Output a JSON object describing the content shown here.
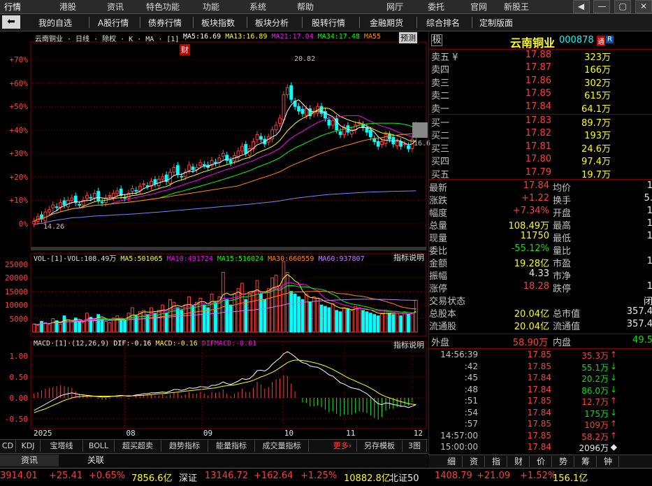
{
  "menu": [
    "行情",
    "港股",
    "资讯",
    "特色功能",
    "功能",
    "系统",
    "帮助",
    "网厅",
    "委托",
    "官网",
    "新股王"
  ],
  "window_buttons": [
    "◀",
    "—",
    "▢",
    "✕"
  ],
  "nav": [
    "我的自选",
    "A股行情",
    "债券行情",
    "板块指数",
    "板块分析",
    "股转行情",
    "金融期货",
    "综合排名",
    "定制版面"
  ],
  "main_chart": {
    "title": "云南铜业 · 日线 · 除权 · K · MA · [1] ·",
    "ma_legend": [
      {
        "text": "MA5:16.69",
        "color": "#ffffff"
      },
      {
        "text": "MA13:16.89",
        "color": "#ffff00"
      },
      {
        "text": "MA21:17.04",
        "color": "#ff00ff"
      },
      {
        "text": "MA34:17.48",
        "color": "#00ff00"
      },
      {
        "text": "MA55",
        "color": "#ff8c00"
      }
    ],
    "predict_btn": "预测",
    "cai_badge": "财",
    "y_ticks": [
      "+70%",
      "+60%",
      "+50%",
      "+40%",
      "+30%",
      "+20%",
      "+10%",
      "0%"
    ],
    "high_label": "20.82",
    "low_label": "14.26",
    "last_label": "16.6"
  },
  "vol_chart": {
    "legend": [
      {
        "text": "VOL·[1]·VOL:108.49万",
        "color": "#e0e0e0"
      },
      {
        "text": "MA5:501065",
        "color": "#ffff00"
      },
      {
        "text": "MA10:491724",
        "color": "#ff00ff"
      },
      {
        "text": "MA15:516024",
        "color": "#00ff00"
      },
      {
        "text": "MA30:660559",
        "color": "#ff8c00"
      },
      {
        "text": "MA60:937807",
        "color": "#c080ff"
      }
    ],
    "explain": "指标说明",
    "y_ticks": [
      "25000",
      "20000",
      "15000",
      "10000",
      "5000"
    ]
  },
  "macd_chart": {
    "legend": [
      {
        "text": "MACD·[1]·(12,26,9)",
        "color": "#e0e0e0"
      },
      {
        "text": "DIF:-0.16",
        "color": "#ffffff"
      },
      {
        "text": "MACD:-0.16",
        "color": "#ffff00"
      },
      {
        "text": "DIFMACD:-0.01",
        "color": "#ff00ff"
      }
    ],
    "explain": "指标说明",
    "y_ticks": [
      "1.00",
      "0.50",
      "0.00",
      "-0.50"
    ],
    "x_ticks": [
      "2025",
      "08",
      "09",
      "10",
      "11",
      "12"
    ]
  },
  "index_tabs": [
    "CD",
    "KDJ",
    "宝塔线",
    "BOLL",
    "超买超卖",
    "趋势指标",
    "能量指标",
    "成交量指标",
    "更多›",
    "另存模板",
    "3图"
  ],
  "sub_tabs": [
    "资讯",
    "关联"
  ],
  "right_tabs": [
    "细",
    "资",
    "指",
    "财",
    "价",
    "势",
    "筹",
    "钟"
  ],
  "stock": {
    "flag": "极",
    "name": "云南铜业",
    "code": "000878",
    "badges": [
      "通",
      "R"
    ]
  },
  "asks": [
    {
      "label": "卖五 ¥",
      "price": "17.88",
      "vol": "323万"
    },
    {
      "label": "卖四",
      "price": "17.87",
      "vol": "166万"
    },
    {
      "label": "卖三",
      "price": "17.86",
      "vol": "302万"
    },
    {
      "label": "卖二",
      "price": "17.85",
      "vol": "615万"
    },
    {
      "label": "卖一",
      "price": "17.84",
      "vol": "64.1万"
    }
  ],
  "bids": [
    {
      "label": "买一",
      "price": "17.83",
      "vol": "89.7万"
    },
    {
      "label": "买二",
      "price": "17.82",
      "vol": "193万"
    },
    {
      "label": "买三",
      "price": "17.81",
      "vol": "24.6万"
    },
    {
      "label": "买四",
      "price": "17.80",
      "vol": "97.4万"
    },
    {
      "label": "买五",
      "price": "17.79",
      "vol": "19.7万"
    }
  ],
  "stats": [
    {
      "l": "最新",
      "v": "17.84",
      "c": "red",
      "l2": "均价",
      "v2": "1"
    },
    {
      "l": "涨跌",
      "v": "+1.22",
      "c": "red",
      "l2": "换手",
      "v2": "5."
    },
    {
      "l": "幅度",
      "v": "+7.34%",
      "c": "red",
      "l2": "开盘",
      "v2": "1"
    },
    {
      "l": "总量",
      "v": "108.49万",
      "c": "yellow",
      "l2": "最高",
      "v2": "1"
    },
    {
      "l": "现量",
      "v": "11750",
      "c": "yellow",
      "l2": "最低",
      "v2": "1"
    },
    {
      "l": "委比",
      "v": "-55.12%",
      "c": "green",
      "l2": "量比",
      "v2": ""
    },
    {
      "l": "金额",
      "v": "19.28亿",
      "c": "yellow",
      "l2": "市盈",
      "v2": "1"
    },
    {
      "l": "振幅",
      "v": "4.33",
      "c": "white",
      "l2": "市净",
      "v2": ""
    },
    {
      "l": "涨停",
      "v": "18.28",
      "c": "red",
      "l2": "跌停",
      "v2": "1"
    },
    {
      "l": "交易状态",
      "v": "",
      "c": "white",
      "l2": "",
      "v2": "闭"
    },
    {
      "l": "总股本",
      "v": "20.04亿",
      "c": "yellow",
      "l2": "总市值",
      "v2": "357.4"
    },
    {
      "l": "流通股",
      "v": "20.04亿",
      "c": "yellow",
      "l2": "流通值",
      "v2": "357.4"
    }
  ],
  "outer_inner": {
    "out_l": "外盘",
    "out_v": "58.90万",
    "in_l": "内盘",
    "in_v": "49.5"
  },
  "ticks": [
    {
      "t": "14:56:39",
      "p": "17.85",
      "v": "35.3万",
      "d": "↑",
      "dc": "red"
    },
    {
      "t": ":42",
      "p": "17.85",
      "v": "55.1万",
      "d": "↓",
      "dc": "green"
    },
    {
      "t": ":45",
      "p": "17.84",
      "v": "20.2万",
      "d": "↓",
      "dc": "green"
    },
    {
      "t": ":48",
      "p": "17.84",
      "v": "86.0万",
      "d": "↓",
      "dc": "green"
    },
    {
      "t": ":51",
      "p": "17.85",
      "v": "12.7万",
      "d": "↑",
      "dc": "red"
    },
    {
      "t": ":54",
      "p": "17.84",
      "v": "175万",
      "d": "↓",
      "dc": "green"
    },
    {
      "t": ":57",
      "p": "17.85",
      "v": "109万",
      "d": "↑",
      "dc": "red"
    },
    {
      "t": "14:57:00",
      "p": "17.85",
      "v": "58.2万",
      "d": "↑",
      "dc": "red"
    },
    {
      "t": "15:00:00",
      "p": "17.84",
      "v": "2096万",
      "d": "◆",
      "dc": "white"
    }
  ],
  "status": [
    {
      "text": "3914.01",
      "c": "red"
    },
    {
      "text": "+25.41",
      "c": "red"
    },
    {
      "text": "+0.65%",
      "c": "red"
    },
    {
      "text": "7856.6亿",
      "c": "yellow"
    },
    {
      "text": "深证",
      "c": "white"
    },
    {
      "text": "13146.72",
      "c": "red"
    },
    {
      "text": "+162.64",
      "c": "red"
    },
    {
      "text": "+1.25%",
      "c": "red"
    },
    {
      "text": "10882.8亿",
      "c": "yellow"
    },
    {
      "text": "北证50",
      "c": "white"
    },
    {
      "text": "1408.79",
      "c": "red"
    },
    {
      "text": "+21.09",
      "c": "red"
    },
    {
      "text": "+1.52%",
      "c": "red"
    },
    {
      "text": "156.1亿",
      "c": "yellow"
    }
  ],
  "colors": {
    "up": "#ff3c3c",
    "down": "#00ffff",
    "grid": "#800000",
    "bg": "#000000"
  },
  "chart_data": {
    "type": "candlestick",
    "title": "云南铜业 日线",
    "ylabel": "",
    "ylim_pct": [
      -3,
      73
    ],
    "x_ticks": [
      "2025",
      "08",
      "09",
      "10",
      "11",
      "12"
    ],
    "close_pct": [
      1,
      3,
      2,
      5,
      6,
      8,
      7,
      9,
      8,
      10,
      11,
      9,
      8,
      10,
      12,
      11,
      13,
      10,
      9,
      11,
      12,
      13,
      14,
      12,
      11,
      13,
      15,
      14,
      16,
      17,
      16,
      18,
      17,
      19,
      20,
      18,
      22,
      24,
      21,
      20,
      22,
      25,
      23,
      24,
      26,
      25,
      24,
      27,
      26,
      28,
      30,
      27,
      26,
      29,
      31,
      33,
      30,
      32,
      35,
      38,
      36,
      34,
      37,
      40,
      42,
      45,
      55,
      58,
      53,
      50,
      48,
      47,
      49,
      46,
      48,
      50,
      47,
      45,
      42,
      44,
      40,
      38,
      41,
      39,
      40,
      42,
      43,
      41,
      39,
      37,
      35,
      33,
      35,
      38,
      36,
      34,
      35,
      33,
      34,
      32,
      36,
      42
    ],
    "volume": [
      3000,
      2500,
      4000,
      3500,
      2800,
      5000,
      4200,
      3000,
      6000,
      4500,
      3800,
      5200,
      4000,
      3600,
      7000,
      5500,
      4200,
      6500,
      5000,
      4000,
      3500,
      5200,
      6000,
      4800,
      4500,
      7000,
      9000,
      6000,
      7500,
      8000,
      6500,
      9000,
      7000,
      8000,
      10000,
      7000,
      12000,
      11000,
      9000,
      8000,
      10000,
      13000,
      9500,
      11000,
      12500,
      10000,
      9000,
      14000,
      11000,
      13000,
      22000,
      12000,
      10000,
      14000,
      16000,
      18000,
      12000,
      14000,
      15000,
      19000,
      14000,
      12000,
      16000,
      20000,
      21000,
      17000,
      26000,
      22000,
      15000,
      14000,
      13000,
      12000,
      14000,
      11000,
      13000,
      12500,
      10000,
      9500,
      9000,
      10500,
      8000,
      7500,
      9000,
      8500,
      8000,
      9500,
      9000,
      8000,
      7500,
      7000,
      6500,
      6000,
      7000,
      8000,
      7000,
      6500,
      7000,
      6000,
      7500,
      6500,
      7000,
      11750
    ],
    "macd_dif": [
      -0.3,
      -0.25,
      -0.2,
      -0.15,
      -0.1,
      -0.05,
      0.0,
      0.05,
      0.08,
      0.1,
      0.12,
      0.1,
      0.08,
      0.07,
      0.06,
      0.05,
      0.04,
      0.03,
      0.02,
      0.02,
      0.03,
      0.04,
      0.05,
      0.06,
      0.05,
      0.04,
      0.05,
      0.07,
      0.08,
      0.1,
      0.1,
      0.12,
      0.12,
      0.13,
      0.14,
      0.13,
      0.16,
      0.2,
      0.2,
      0.18,
      0.2,
      0.24,
      0.23,
      0.24,
      0.27,
      0.26,
      0.25,
      0.3,
      0.3,
      0.33,
      0.38,
      0.34,
      0.32,
      0.36,
      0.4,
      0.46,
      0.44,
      0.46,
      0.54,
      0.65,
      0.66,
      0.64,
      0.7,
      0.8,
      0.88,
      0.95,
      1.05,
      1.1,
      1.05,
      0.98,
      0.9,
      0.84,
      0.82,
      0.76,
      0.74,
      0.73,
      0.68,
      0.62,
      0.55,
      0.52,
      0.44,
      0.36,
      0.33,
      0.28,
      0.24,
      0.22,
      0.2,
      0.15,
      0.1,
      0.02,
      -0.06,
      -0.14,
      -0.16,
      -0.12,
      -0.13,
      -0.16,
      -0.17,
      -0.2,
      -0.2,
      -0.23,
      -0.2,
      -0.16
    ],
    "macd_dea": [
      -0.35,
      -0.32,
      -0.29,
      -0.26,
      -0.22,
      -0.18,
      -0.14,
      -0.1,
      -0.06,
      -0.03,
      0.0,
      0.02,
      0.03,
      0.04,
      0.04,
      0.04,
      0.04,
      0.04,
      0.04,
      0.04,
      0.04,
      0.04,
      0.04,
      0.05,
      0.05,
      0.05,
      0.05,
      0.05,
      0.06,
      0.06,
      0.07,
      0.08,
      0.09,
      0.1,
      0.1,
      0.11,
      0.12,
      0.13,
      0.14,
      0.15,
      0.16,
      0.17,
      0.18,
      0.19,
      0.2,
      0.21,
      0.22,
      0.23,
      0.24,
      0.26,
      0.28,
      0.29,
      0.3,
      0.31,
      0.33,
      0.35,
      0.37,
      0.39,
      0.42,
      0.46,
      0.5,
      0.53,
      0.57,
      0.61,
      0.66,
      0.72,
      0.78,
      0.84,
      0.88,
      0.9,
      0.9,
      0.89,
      0.88,
      0.86,
      0.84,
      0.82,
      0.79,
      0.76,
      0.72,
      0.68,
      0.63,
      0.58,
      0.53,
      0.48,
      0.44,
      0.4,
      0.36,
      0.32,
      0.28,
      0.23,
      0.18,
      0.12,
      0.07,
      0.03,
      0.0,
      -0.03,
      -0.06,
      -0.09,
      -0.11,
      -0.14,
      -0.15,
      -0.16
    ]
  }
}
